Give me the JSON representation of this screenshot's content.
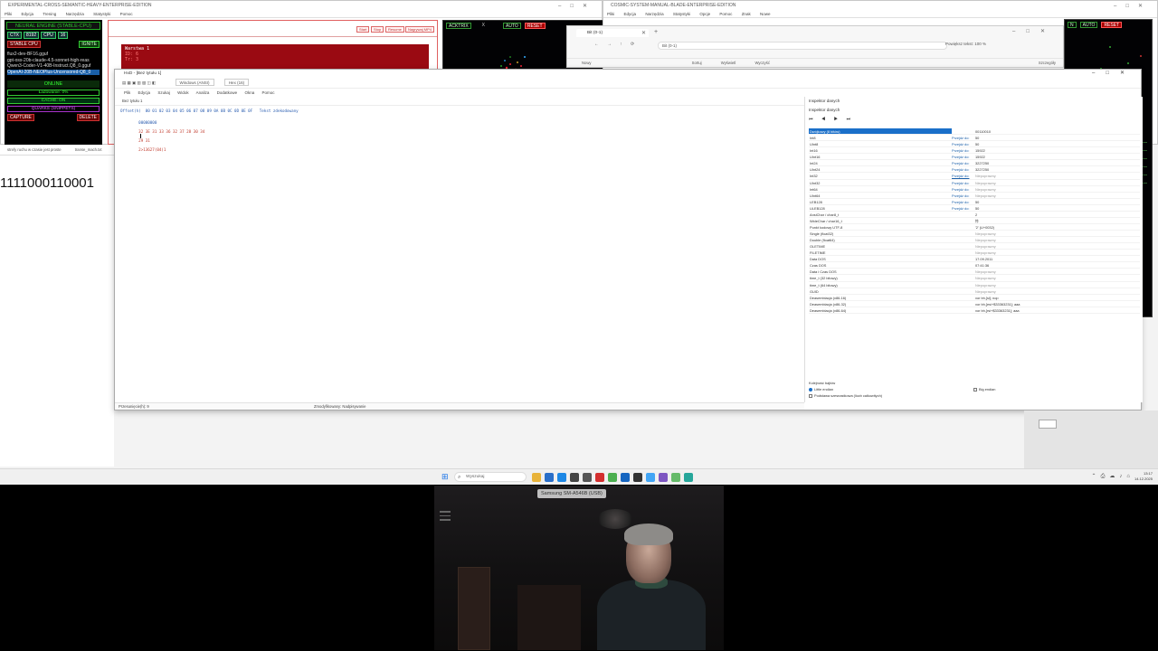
{
  "left_window": {
    "title": "EXPERIMENTAL-CROSS-SEMANTIC-HEAVY-ENTERPRISE-EDITION",
    "menu": [
      "Pliki",
      "Edycja",
      "Trening",
      "Narzędzia",
      "Statystyki",
      "Pomoc"
    ],
    "neural_engine": {
      "title": "NEURAL ENGINE (STABLE-CPU)",
      "chips": [
        "CTX",
        "8192",
        "CPU",
        "16"
      ],
      "stable_label": "STABLE CPU",
      "ignite_label": "IGNITE",
      "models": [
        "flux2-dev-BF16.gguf",
        "gpt-oss-20b-claude-4.5-sonnet-high-reas",
        "Qwen3-Coder-V1-40B-Instruct.Q8_0.gguf",
        "OpenAI-20B-NEOPlus-Uncensored-Q8_0"
      ],
      "online": "ONLINE",
      "loading": "Ładowanie: 0%",
      "cache": "CACHE: ON",
      "quarks": "QUARKS (SNIPPETS)",
      "capture": "CAPTURE",
      "delete": "DELETE"
    },
    "redbox": {
      "buttons": [
        "Start",
        "Stop",
        "Resume",
        "Nagrywaj MP4"
      ],
      "term_lines": [
        "Warstwa 1",
        "ID: 6",
        "Tr: 3"
      ]
    },
    "particle_panel": {
      "label": "ACKTRIX",
      "x": "X",
      "auto": "AUTO",
      "reset": "RESET"
    }
  },
  "right_window": {
    "title": "COSMIC-SYSTEM-MANUAL-BLADE-ENTERPRISE-EDITION",
    "menu": [
      "Pliki",
      "Edycja",
      "Narzędzia",
      "Statystyki",
      "Opcje",
      "Pomoc",
      "Znak",
      "Nowe"
    ],
    "panel": {
      "label": "N",
      "auto": "AUTO",
      "reset": "RESET"
    }
  },
  "browser": {
    "tab": "Bit (0-1)",
    "url": "Bit (0-1)",
    "zoom_label": "Powiększ tekst: 100 %",
    "toolbar": [
      "Nowy",
      "Sortuj",
      "Wyświetl",
      "Wyczyść",
      "Szczegóły"
    ]
  },
  "binstrip": {
    "tabs": [
      "strefy ruchu w czasie jest proste",
      "transe_mach.txt"
    ],
    "binary": "1111000110001"
  },
  "hex_editor": {
    "title": "HxD - [Bez tytułu 1]",
    "toolbar_encoding": "Windows (ANSI)",
    "toolbar_mode": "Hex (16)",
    "menu": [
      "Plik",
      "Edycja",
      "Szukaj",
      "Widok",
      "Analiza",
      "Dodatkowe",
      "Okna",
      "Pomoc"
    ],
    "subtab": "Bez tytułu 1",
    "header": "Offset(h)  00 01 02 03 04 05 06 07 08 09 0A 0B 0C 0D 0E 0F   Tekst zdekodowany",
    "offset": "00000000",
    "bytes": "32 3E 31 33 36 32 37 28 30 34",
    "bytes_tail": "29 31",
    "decoded": "2>13627(04)1",
    "status_left": "Przesunięcie(h): 9",
    "status_mid": "Zmodyfikowany: Nadpisywanie"
  },
  "inspector": {
    "title": "Inspektor danych",
    "subtitle": "Inspektor danych",
    "nav": "⏮ ◀ ▶ ⏭",
    "rows": [
      {
        "type": "Dwójkowy (8 bitów)",
        "link": "",
        "value": "00110010",
        "sel": true
      },
      {
        "type": "Int8",
        "link": "Przejdź do:",
        "value": "50"
      },
      {
        "type": "UInt8",
        "link": "Przejdź do:",
        "value": "50"
      },
      {
        "type": "Int16",
        "link": "Przejdź do:",
        "value": "15922"
      },
      {
        "type": "UInt16",
        "link": "Przejdź do:",
        "value": "15922"
      },
      {
        "type": "Int24",
        "link": "Przejdź do:",
        "value": "3227250"
      },
      {
        "type": "UInt24",
        "link": "Przejdź do:",
        "value": "3227250"
      },
      {
        "type": "Int32",
        "link": "Przejdź do:",
        "value": "Niepoprawny",
        "na": true
      },
      {
        "type": "UInt32",
        "link": "Przejdź do:",
        "value": "Niepoprawny",
        "na": true
      },
      {
        "type": "Int64",
        "link": "Przejdź do:",
        "value": "Niepoprawny",
        "na": true
      },
      {
        "type": "UInt64",
        "link": "Przejdź do:",
        "value": "Niepoprawny",
        "na": true
      },
      {
        "type": "LEB128",
        "link": "Przejdź do:",
        "value": "50"
      },
      {
        "type": "ULEB128",
        "link": "Przejdź do:",
        "value": "50"
      },
      {
        "type": "AnsiChar / char8_t",
        "link": "",
        "value": "2"
      },
      {
        "type": "WideChar / char16_t",
        "link": "",
        "value": "㸲"
      },
      {
        "type": "Punkt kodowy UTF-8",
        "link": "",
        "value": "'2' (U+0032)"
      },
      {
        "type": "Single (float32)",
        "link": "",
        "value": "Niepoprawny",
        "na": true
      },
      {
        "type": "Double (float64)",
        "link": "",
        "value": "Niepoprawny",
        "na": true
      },
      {
        "type": "OLETIME",
        "link": "",
        "value": "Niepoprawny",
        "na": true
      },
      {
        "type": "FILETIME",
        "link": "",
        "value": "Niepoprawny",
        "na": true
      },
      {
        "type": "Data DOS",
        "link": "",
        "value": "17.09.2011"
      },
      {
        "type": "Czas DOS",
        "link": "",
        "value": "07:41:36"
      },
      {
        "type": "Data i Czas DOS",
        "link": "",
        "value": "Niepoprawny",
        "na": true
      },
      {
        "type": "time_t (32 bitowy)",
        "link": "",
        "value": "Niepoprawny",
        "na": true
      },
      {
        "type": "time_t (64 bitowy)",
        "link": "",
        "value": "Niepoprawny",
        "na": true
      },
      {
        "type": "GUID",
        "link": "",
        "value": "Niepoprawny",
        "na": true
      },
      {
        "type": "Deasemblacja (x86-16)",
        "link": "",
        "value": "xor bh,[si]; nop"
      },
      {
        "type": "Deasemblacja (x86-32)",
        "link": "",
        "value": "xor bh,[esi+$33363231]; aaa"
      },
      {
        "type": "Deasemblacja (x86-64)",
        "link": "",
        "value": "xor bh,[rsi+$33363231]; aaa"
      }
    ],
    "order_label": "Kolejność bajtów",
    "little_endian": "Little endian",
    "big_endian": "Big endian",
    "hex_base": "Podstawa szesnastkowa (liczb całkowitych)"
  },
  "taskbar": {
    "search": "Wyszukaj",
    "time": "13:17",
    "date": "14.12.2025"
  },
  "webcam": {
    "label": "Samsung SM-A546B (USB)"
  }
}
